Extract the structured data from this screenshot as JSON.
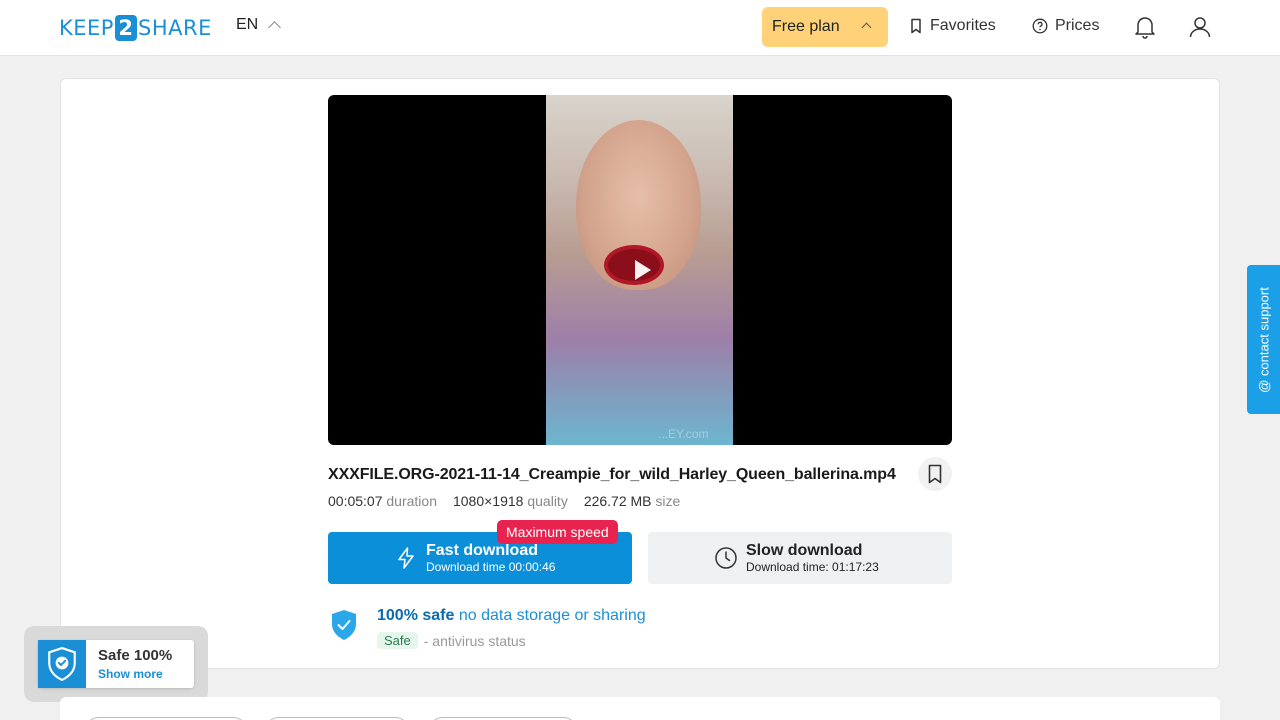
{
  "header": {
    "logo": {
      "left": "KEEP",
      "mid": "2",
      "right": "SHARE"
    },
    "lang": "EN",
    "plan_label": "Free plan",
    "favorites_label": "Favorites",
    "prices_label": "Prices"
  },
  "video": {
    "watermark": "...EY.com"
  },
  "file": {
    "name": "XXXFILE.ORG-2021-11-14_Creampie_for_wild_Harley_Queen_ballerina.mp4",
    "duration": "00:05:07",
    "duration_label": "duration",
    "resolution": "1080×1918",
    "resolution_label": "quality",
    "size": "226.72 MB",
    "size_label": "size"
  },
  "download": {
    "badge": "Maximum speed",
    "fast_title": "Fast download",
    "fast_sub": "Download time 00:00:46",
    "slow_title": "Slow download",
    "slow_sub": "Download time: 01:17:23"
  },
  "safety": {
    "bold": "100% safe",
    "rest": " no data storage or sharing",
    "badge": "Safe",
    "status": "- antivirus status"
  },
  "support_label": "@ contact support",
  "widget": {
    "title": "Safe 100%",
    "more": "Show more"
  },
  "colors": {
    "brand": "#1b8fd6",
    "plan": "#ffd27a",
    "fast_button": "#0c8fd9",
    "badge_red": "#e8234f"
  }
}
